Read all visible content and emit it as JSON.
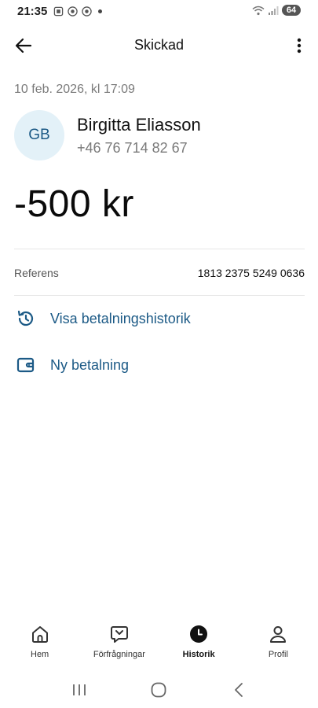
{
  "status_bar": {
    "time": "21:35",
    "battery": "64",
    "icons": [
      "screenshot-icon",
      "chrome-icon",
      "chrome-icon",
      "dot-icon",
      "wifi-icon",
      "signal-icon",
      "battery-icon"
    ]
  },
  "app_bar": {
    "title": "Skickad",
    "back_icon": "arrow-left-icon",
    "more_icon": "more-vertical-icon"
  },
  "transaction": {
    "date": "10 feb. 2026, kl 17:09",
    "initials": "GB",
    "name": "Birgitta Eliasson",
    "phone": "+46 76 714 82 67",
    "amount": "-500 kr",
    "reference_label": "Referens",
    "reference_value": "1813 2375 5249 0636"
  },
  "actions": [
    {
      "label": "Visa betalningshistorik",
      "icon": "history-icon"
    },
    {
      "label": "Ny betalning",
      "icon": "wallet-icon"
    }
  ],
  "bottom_nav": {
    "items": [
      {
        "label": "Hem",
        "icon": "home-icon",
        "active": false
      },
      {
        "label": "Förfrågningar",
        "icon": "request-icon",
        "active": false
      },
      {
        "label": "Historik",
        "icon": "clock-icon",
        "active": true
      },
      {
        "label": "Profil",
        "icon": "profile-icon",
        "active": false
      }
    ]
  },
  "colors": {
    "accent": "#1c5a86",
    "avatar_bg": "#e3f1f8",
    "muted_text": "#7a7a7a"
  }
}
